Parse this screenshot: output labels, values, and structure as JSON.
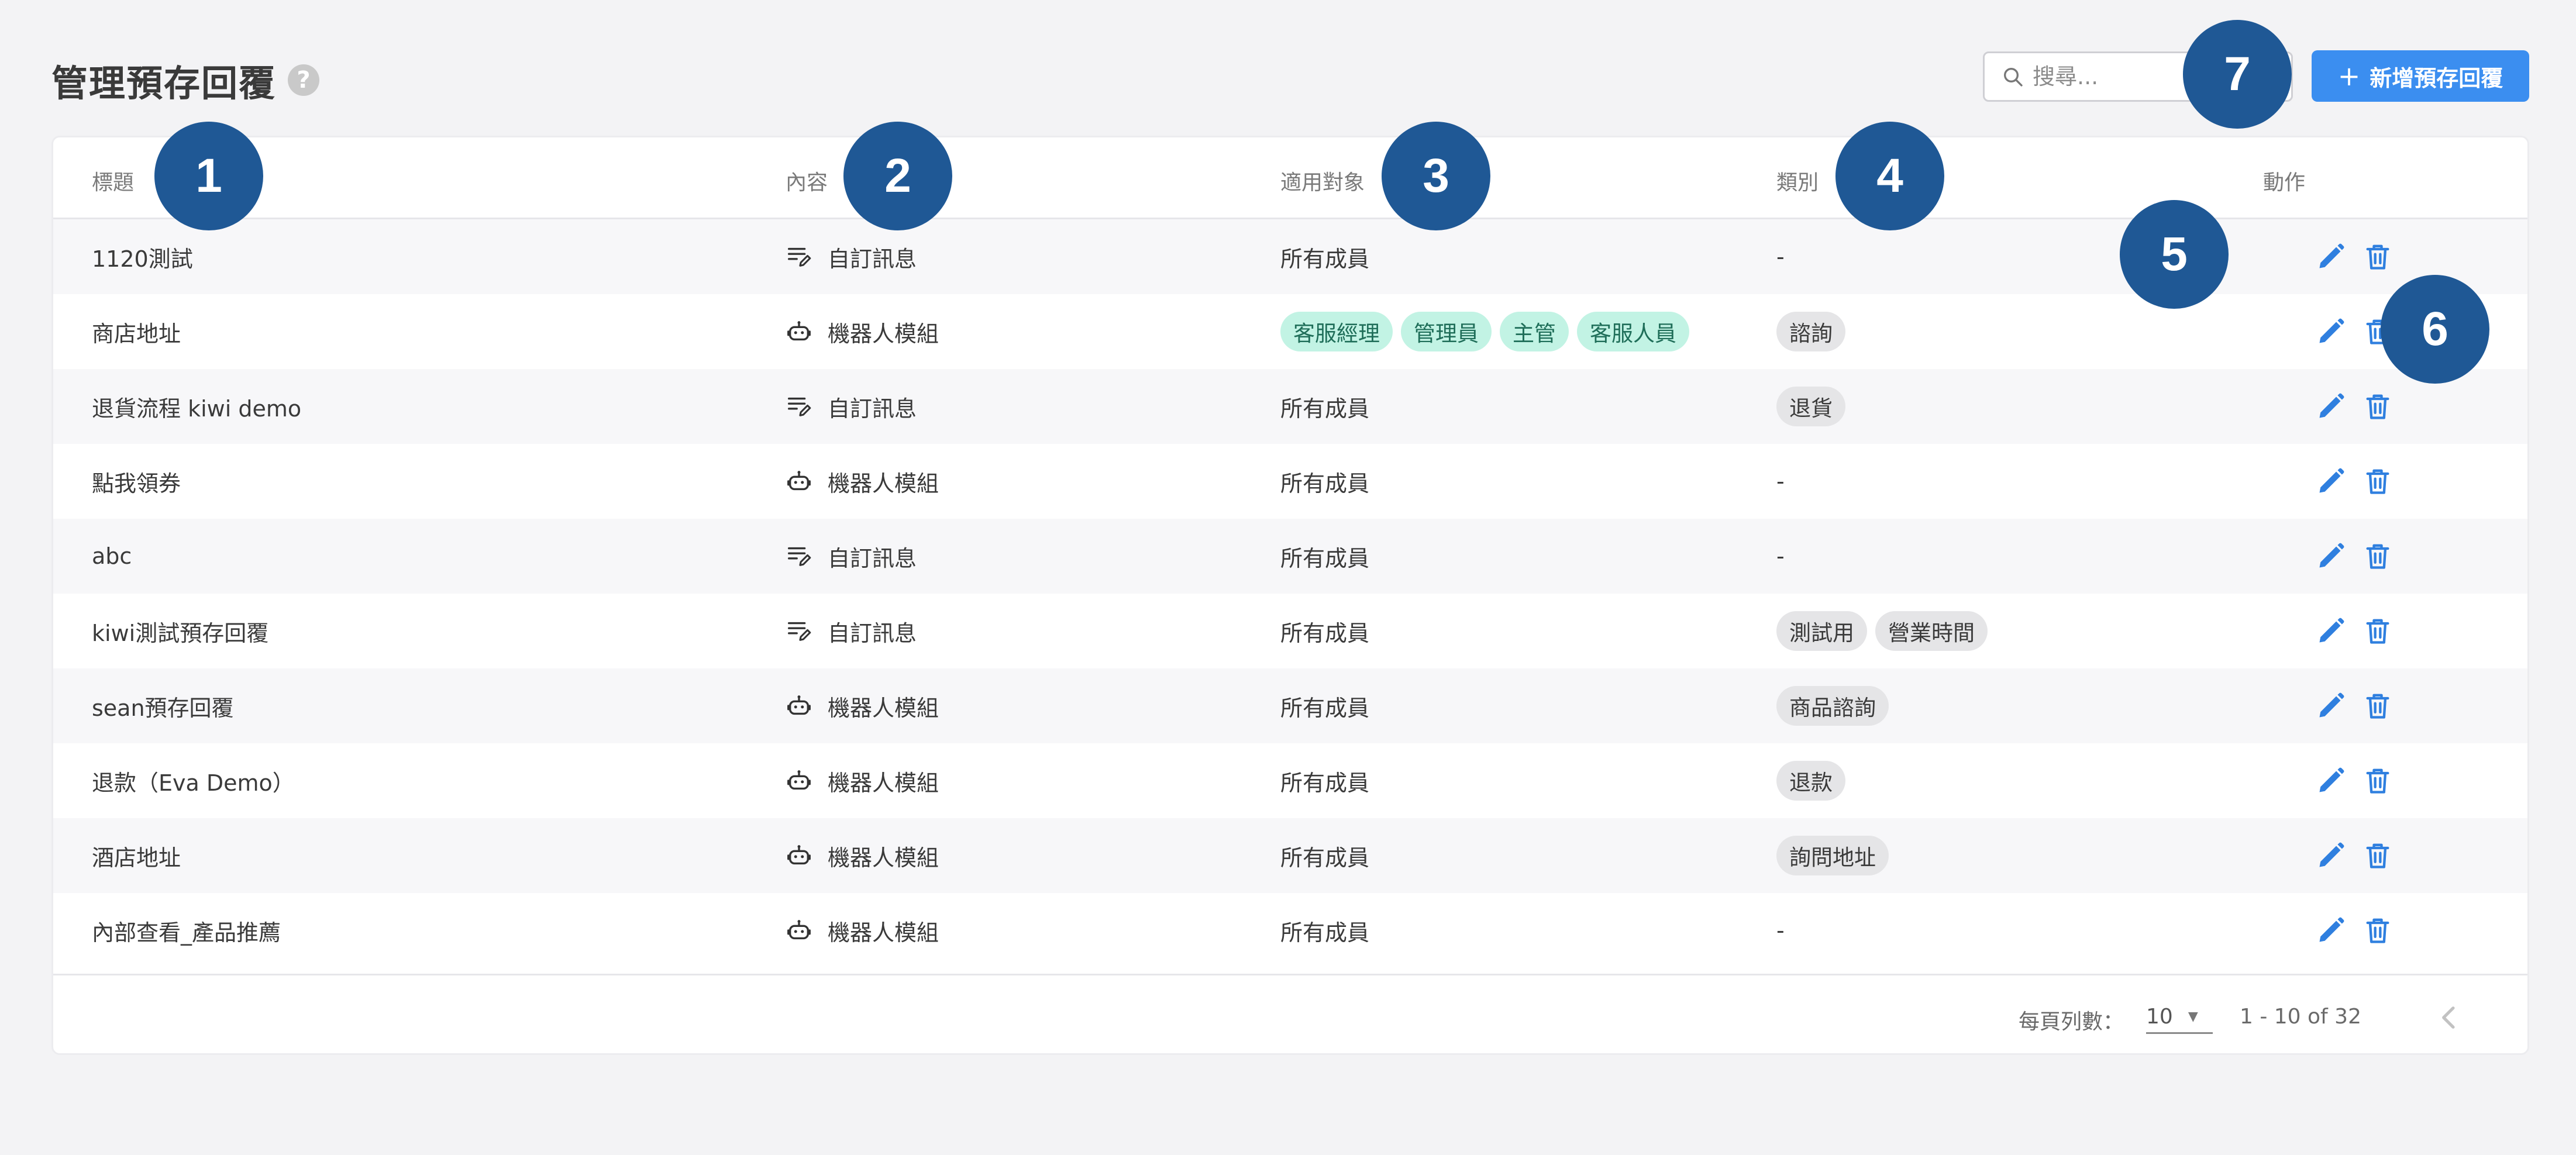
{
  "header": {
    "title": "管理預存回覆",
    "help_icon": "?",
    "search_placeholder": "搜尋...",
    "add_button_label": "新增預存回覆",
    "add_button_icon": "+"
  },
  "columns": [
    "標題",
    "內容",
    "適用對象",
    "類別",
    "動作"
  ],
  "rows": [
    {
      "title": "1120測試",
      "content_type": "自訂訊息",
      "content_icon": "custom-message-icon",
      "audience": "所有成員",
      "audience_tags": [],
      "category": "-",
      "category_tags": []
    },
    {
      "title": "商店地址",
      "content_type": "機器人模組",
      "content_icon": "bot-icon",
      "audience": "",
      "audience_tags": [
        "客服經理",
        "管理員",
        "主管",
        "客服人員"
      ],
      "category": "",
      "category_tags": [
        "諮詢"
      ]
    },
    {
      "title": "退貨流程 kiwi demo",
      "content_type": "自訂訊息",
      "content_icon": "custom-message-icon",
      "audience": "所有成員",
      "audience_tags": [],
      "category": "",
      "category_tags": [
        "退貨"
      ]
    },
    {
      "title": "點我領券",
      "content_type": "機器人模組",
      "content_icon": "bot-icon",
      "audience": "所有成員",
      "audience_tags": [],
      "category": "-",
      "category_tags": []
    },
    {
      "title": "abc",
      "content_type": "自訂訊息",
      "content_icon": "custom-message-icon",
      "audience": "所有成員",
      "audience_tags": [],
      "category": "-",
      "category_tags": []
    },
    {
      "title": "kiwi測試預存回覆",
      "content_type": "自訂訊息",
      "content_icon": "custom-message-icon",
      "audience": "所有成員",
      "audience_tags": [],
      "category": "",
      "category_tags": [
        "測試用",
        "營業時間"
      ]
    },
    {
      "title": "sean預存回覆",
      "content_type": "機器人模組",
      "content_icon": "bot-icon",
      "audience": "所有成員",
      "audience_tags": [],
      "category": "",
      "category_tags": [
        "商品諮詢"
      ]
    },
    {
      "title": "退款（Eva Demo）",
      "content_type": "機器人模組",
      "content_icon": "bot-icon",
      "audience": "所有成員",
      "audience_tags": [],
      "category": "",
      "category_tags": [
        "退款"
      ]
    },
    {
      "title": "酒店地址",
      "content_type": "機器人模組",
      "content_icon": "bot-icon",
      "audience": "所有成員",
      "audience_tags": [],
      "category": "",
      "category_tags": [
        "詢問地址"
      ]
    },
    {
      "title": "內部查看_產品推薦",
      "content_type": "機器人模組",
      "content_icon": "bot-icon",
      "audience": "所有成員",
      "audience_tags": [],
      "category": "-",
      "category_tags": []
    }
  ],
  "actions": {
    "edit_icon": "pencil-icon",
    "delete_icon": "trash-icon"
  },
  "pagination": {
    "rows_per_page_label": "每頁列數：",
    "rows_per_page": "10",
    "range_label": "1 - 10 of 32"
  },
  "markers": [
    "1",
    "2",
    "3",
    "4",
    "5",
    "6",
    "7"
  ],
  "colors": {
    "accent": "#3b8ef0",
    "marker": "#1f5895",
    "chip_green": "#c2f3e4",
    "chip_gray": "#e5e5e7"
  }
}
